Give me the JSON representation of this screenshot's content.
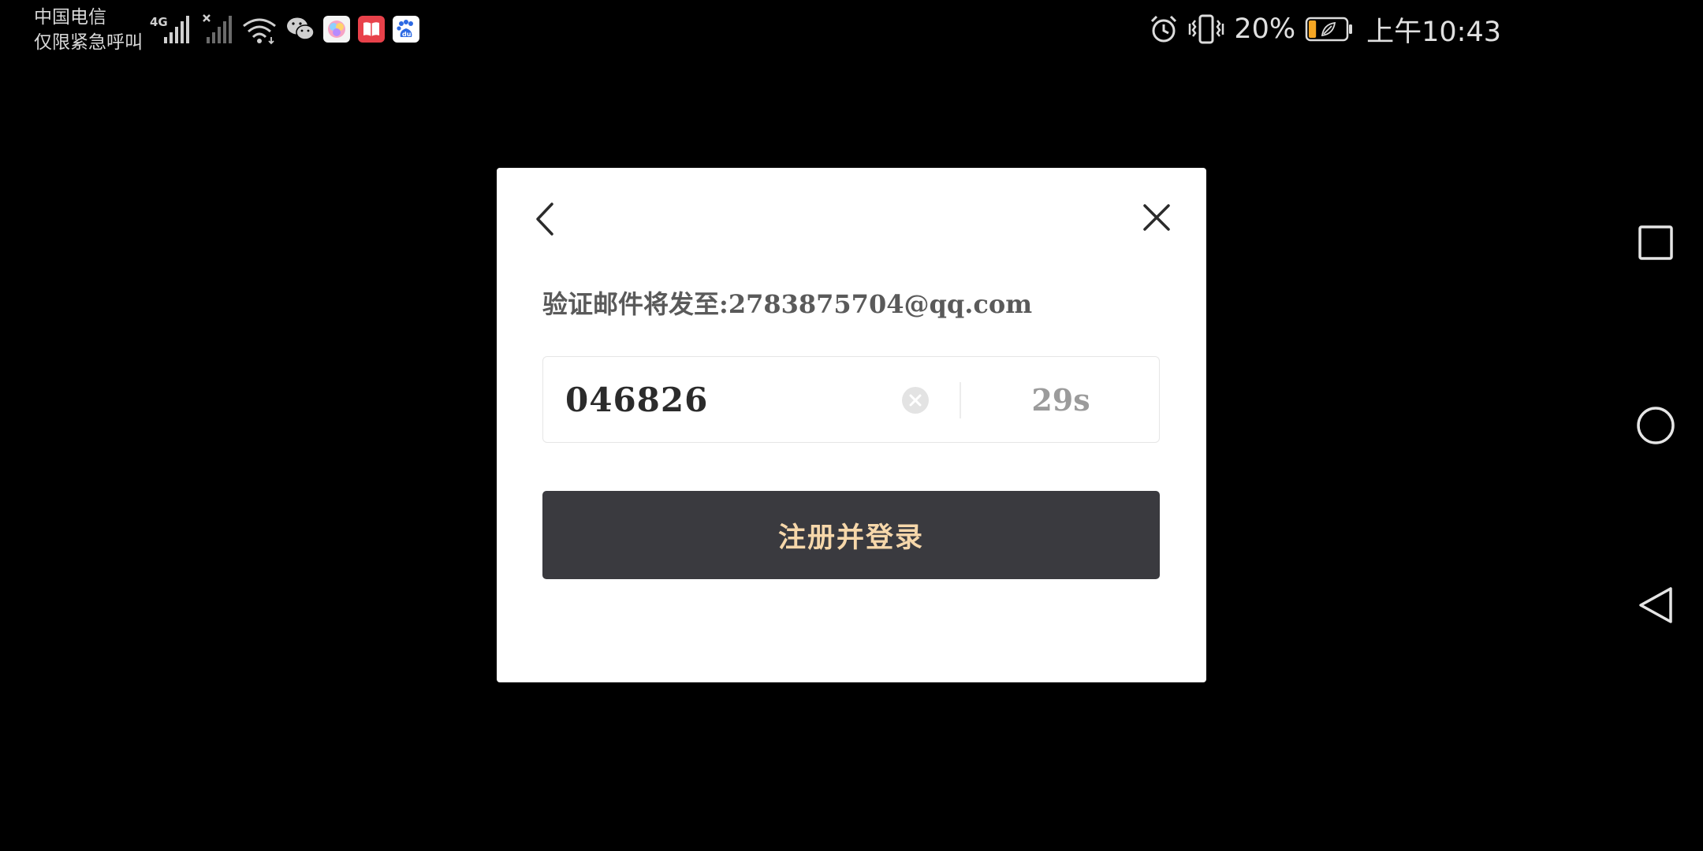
{
  "status_bar": {
    "carrier_line1": "中国电信",
    "carrier_line2": "仅限紧急呼叫",
    "network_label": "4G",
    "battery_percent": "20%",
    "time": "上午10:43",
    "left_icons": [
      "signal-icon",
      "no-signal-icon",
      "wifi-icon",
      "wechat-icon",
      "app-icon",
      "book-app-icon",
      "baidu-icon"
    ],
    "right_icons": [
      "alarm-icon",
      "vibrate-icon",
      "battery-icon"
    ],
    "battery_level": 0.2,
    "battery_color": "#f5a623"
  },
  "dialog": {
    "back_icon": "chevron-left-icon",
    "close_icon": "close-icon",
    "hint_text": "验证邮件将发至:2783875704@qq.com",
    "code_value": "046826",
    "clear_icon": "clear-circle-icon",
    "countdown": "29s",
    "submit_label": "注册并登录",
    "submit_bg": "#3a3a3f",
    "submit_text_color": "#f6d7aa"
  },
  "nav_bar": {
    "recents_icon": "square-icon",
    "home_icon": "circle-icon",
    "back_icon": "triangle-back-icon"
  }
}
